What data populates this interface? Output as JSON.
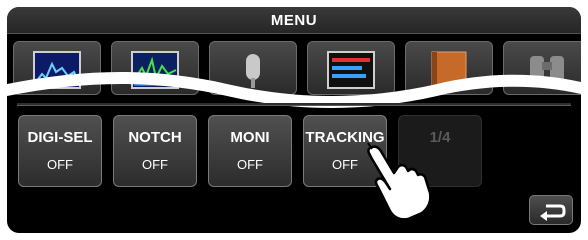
{
  "header": {
    "title": "MENU"
  },
  "icon_row": [
    {
      "icon": "spectrum-scope-icon"
    },
    {
      "icon": "audio-scope-icon"
    },
    {
      "icon": "voice-tx-icon"
    },
    {
      "icon": "meter-icon"
    },
    {
      "icon": "memory-book-icon"
    },
    {
      "icon": "binoculars-icon"
    }
  ],
  "functions": [
    {
      "label": "DIGI-SEL",
      "state": "OFF"
    },
    {
      "label": "NOTCH",
      "state": "OFF"
    },
    {
      "label": "MONI",
      "state": "OFF"
    },
    {
      "label": "TRACKING",
      "state": "OFF"
    }
  ],
  "page_indicator": "1/4",
  "back_icon": "return-arrow-icon",
  "pointer_icon": "tap-hand-icon"
}
